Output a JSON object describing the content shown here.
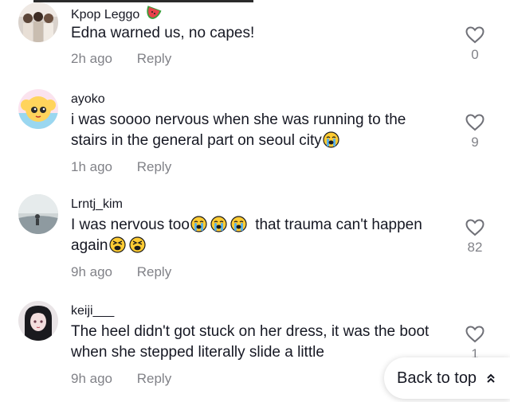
{
  "comments": [
    {
      "username": "Kpop Leggo",
      "badge_icon": "watermelon-icon",
      "text": "Edna warned us, no capes!",
      "time": "2h ago",
      "reply": "Reply",
      "likes": "0"
    },
    {
      "username": "ayoko",
      "text": "i was soooo nervous when she was running to the stairs in the general part on seoul city",
      "emoji_after": [
        "loudly-crying-face"
      ],
      "time": "1h ago",
      "reply": "Reply",
      "likes": "9"
    },
    {
      "username": "Lrntj_kim",
      "text_part1": "I was nervous too",
      "emoji_mid": [
        "loudly-crying-face",
        "loudly-crying-face",
        "loudly-crying-face"
      ],
      "text_part2": " that trauma can't happen again",
      "emoji_after": [
        "tired-face",
        "tired-face"
      ],
      "time": "9h ago",
      "reply": "Reply",
      "likes": "82"
    },
    {
      "username": "keiji___",
      "text": "The heel didn't got stuck on her dress, it was the boot when she stepped literally slide a little",
      "time": "9h ago",
      "reply": "Reply",
      "likes": "1"
    }
  ],
  "back_to_top": {
    "label": "Back to top",
    "icon": "double-chevron-up-icon"
  },
  "colors": {
    "text": "#161823",
    "muted": "#8a8b91",
    "emoji": "#ffcc33"
  }
}
